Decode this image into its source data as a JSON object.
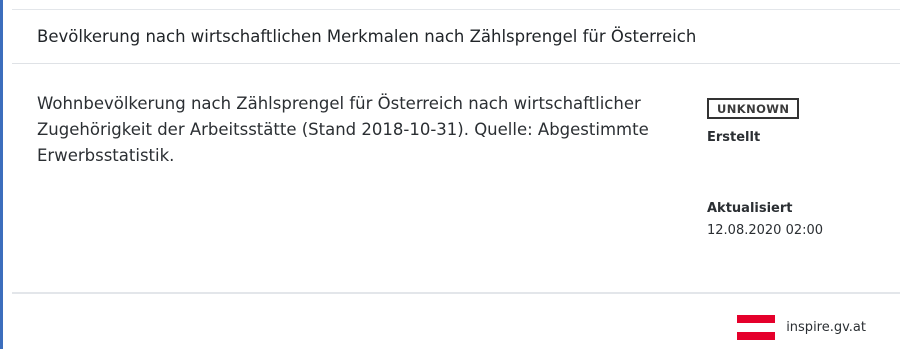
{
  "header": {
    "title": "Bevölkerung nach wirtschaftlichen Merkmalen nach Zählsprengel für Österreich"
  },
  "body": {
    "description": "Wohnbevölkerung nach Zählsprengel für Österreich nach wirtschaftlicher Zugehörigkeit der Arbeitsstätte (Stand 2018-10-31). Quelle: Abgestimmte Erwerbsstatistik."
  },
  "meta": {
    "badge": "UNKNOWN",
    "created_label": "Erstellt",
    "updated_label": "Aktualisiert",
    "updated_value": "12.08.2020 02:00"
  },
  "footer": {
    "source_link": "inspire.gv.at"
  },
  "colors": {
    "accent_border": "#3c6ebd",
    "flag_red": "#e5002b"
  },
  "icons": {
    "flag": "austria-flag-icon"
  }
}
